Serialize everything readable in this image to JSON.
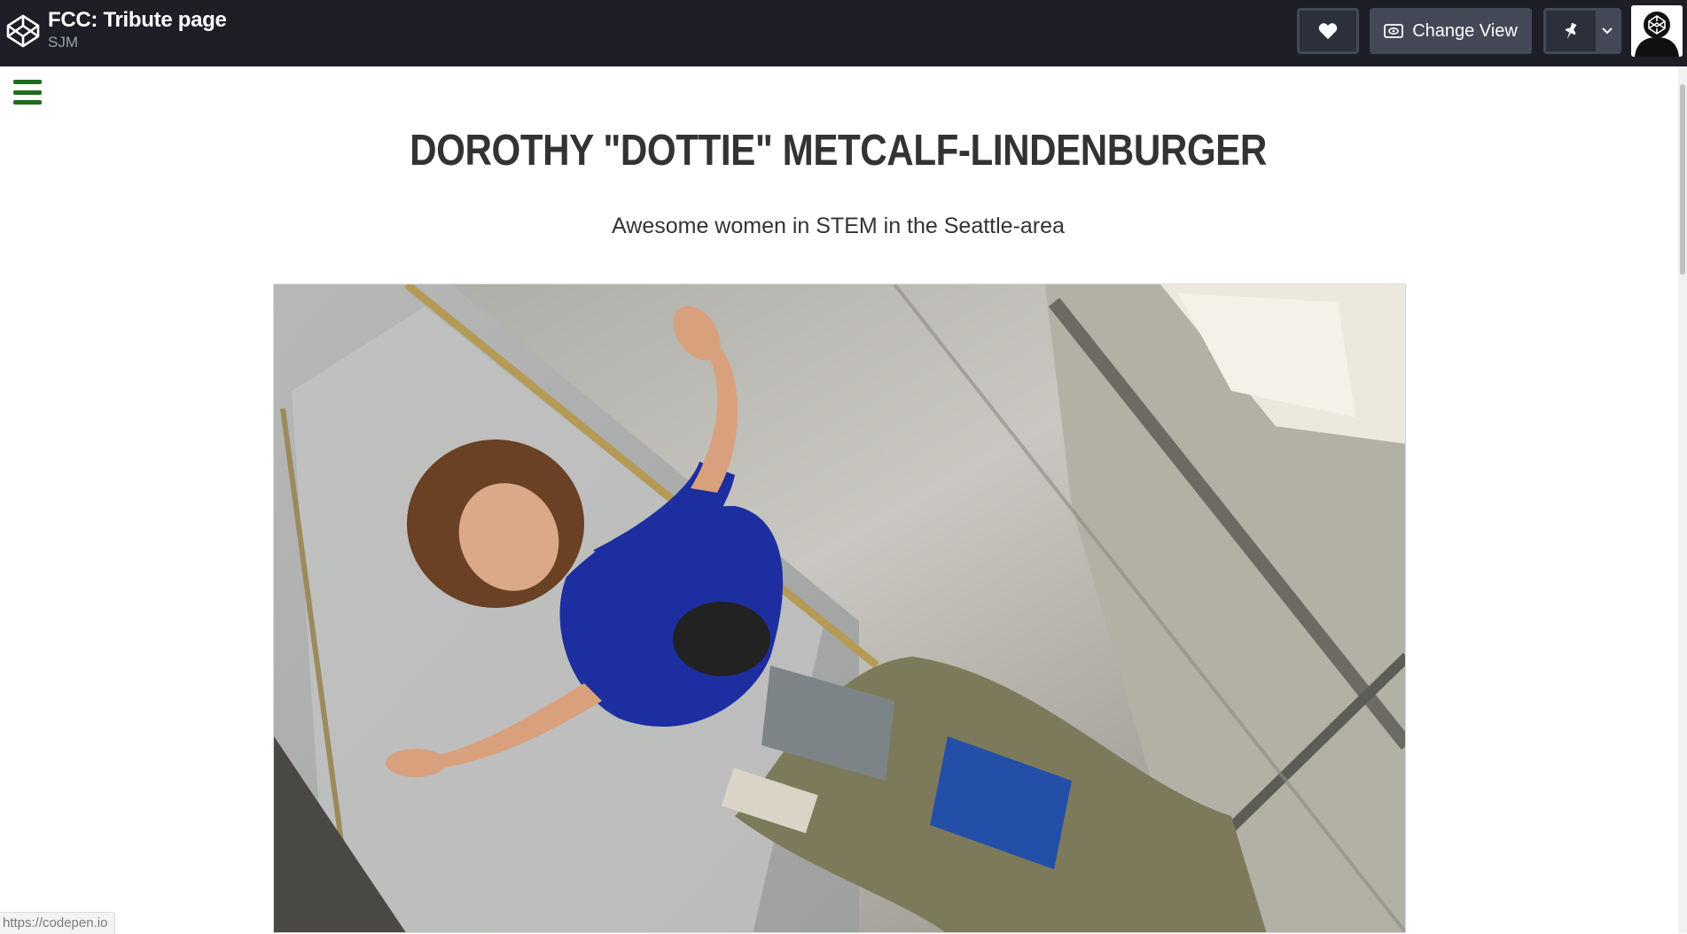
{
  "topbar": {
    "title": "FCC: Tribute page",
    "author": "SJM",
    "change_view_label": "Change View",
    "icons": [
      "codepen-logo-icon",
      "heart-icon",
      "eye-icon",
      "pin-icon",
      "chevron-down-icon",
      "avatar"
    ]
  },
  "page": {
    "title": "DOROTHY \"DOTTIE\" METCALF-LINDENBURGER",
    "subtitle": "Awesome women in STEM in the Seattle-area",
    "menu_icon": "hamburger-menu-icon",
    "accent_color": "#1e6b1e"
  },
  "status_bar": {
    "url": "https://codepen.io"
  }
}
